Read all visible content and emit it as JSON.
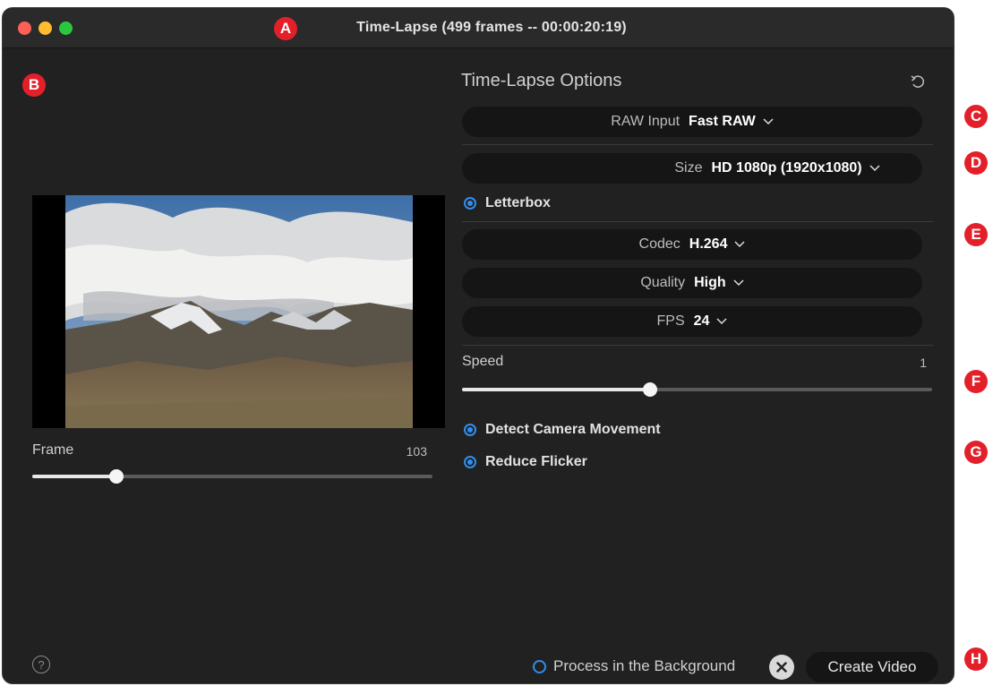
{
  "window": {
    "title": "Time-Lapse (499 frames -- 00:00:20:19)"
  },
  "callouts": [
    "A",
    "B",
    "C",
    "D",
    "E",
    "F",
    "G",
    "H"
  ],
  "preview": {
    "frame_label": "Frame",
    "frame_value": "103",
    "frame_slider_fraction": 0.21
  },
  "options": {
    "title": "Time-Lapse Options",
    "raw_input": {
      "label": "RAW Input",
      "value": "Fast RAW"
    },
    "size": {
      "label": "Size",
      "value": "HD 1080p (1920x1080)"
    },
    "letterbox": {
      "label": "Letterbox",
      "checked": true
    },
    "codec": {
      "label": "Codec",
      "value": "H.264"
    },
    "quality": {
      "label": "Quality",
      "value": "High"
    },
    "fps": {
      "label": "FPS",
      "value": "24"
    },
    "speed": {
      "label": "Speed",
      "value": "1",
      "slider_fraction": 0.4
    },
    "detect_camera_movement": {
      "label": "Detect Camera Movement",
      "checked": true
    },
    "reduce_flicker": {
      "label": "Reduce Flicker",
      "checked": true
    }
  },
  "footer": {
    "help": "?",
    "process_background": {
      "label": "Process in the Background",
      "checked": false
    },
    "create_label": "Create Video"
  },
  "colors": {
    "accent": "#2f8ef0",
    "callout": "#e3202a",
    "window_bg": "#212121",
    "pill_bg": "#151515"
  }
}
